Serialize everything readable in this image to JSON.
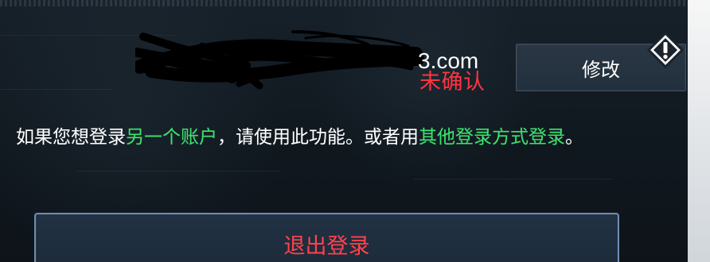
{
  "account": {
    "email_visible": "3.com",
    "status": "未确认",
    "edit_button_label": "修改"
  },
  "info": {
    "prefix": "如果您想登录",
    "link1": "另一个账户",
    "middle": "，请使用此功能。或者用",
    "link2": "其他登录方式登录",
    "suffix": "。"
  },
  "logout": {
    "label": "退出登录"
  },
  "icons": {
    "warning": "warning-icon",
    "redaction": "redaction-scribble"
  },
  "colors": {
    "status_red": "#ff343f",
    "link_green": "#38e46a",
    "button_border": "#6f8db1"
  }
}
